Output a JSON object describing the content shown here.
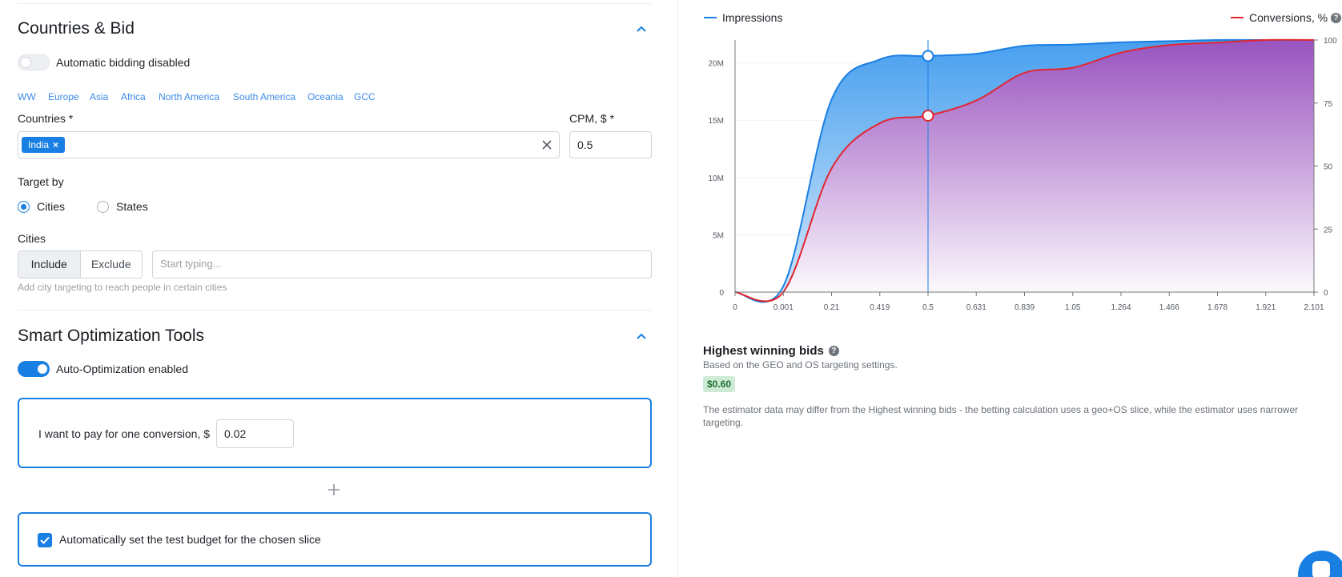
{
  "countries_bid": {
    "title": "Countries & Bid",
    "auto_bidding_label": "Automatic bidding disabled",
    "regions": [
      "WW",
      "Europe",
      "Asia",
      "Africa",
      "North America",
      "South America",
      "Oceania",
      "GCC"
    ],
    "countries_label": "Countries *",
    "selected_country": "India",
    "chip_remove": "×",
    "cpm_label": "CPM, $ *",
    "cpm_value": "0.5",
    "target_by_label": "Target by",
    "target_options": [
      "Cities",
      "States"
    ],
    "selected_target": "Cities",
    "cities_label": "Cities",
    "include_label": "Include",
    "exclude_label": "Exclude",
    "cities_placeholder": "Start typing...",
    "cities_hint": "Add city targeting to reach people in certain cities"
  },
  "smart_tools": {
    "title": "Smart Optimization Tools",
    "auto_opt_label": "Auto-Optimization enabled",
    "pay_label": "I want to pay for one conversion, $",
    "pay_value": "0.02",
    "test_budget_label": "Automatically set the test budget for the chosen slice"
  },
  "chart_data": {
    "type": "area",
    "legend": {
      "impressions": "Impressions",
      "conversions": "Conversions, %"
    },
    "x_ticks": [
      "0",
      "0.001",
      "0.21",
      "0.419",
      "0.5",
      "0.631",
      "0.839",
      "1.05",
      "1.264",
      "1.466",
      "1.678",
      "1.921",
      "2.101"
    ],
    "y_left_ticks": [
      "0",
      "5M",
      "10M",
      "15M",
      "20M"
    ],
    "y_right_ticks": [
      "0",
      "25",
      "50",
      "75",
      "100"
    ],
    "y_left_range": [
      0,
      20000000
    ],
    "y_right_range": [
      0,
      100
    ],
    "series": [
      {
        "name": "Impressions",
        "color": "#1a7fe3",
        "points": [
          [
            0,
            0
          ],
          [
            0.001,
            500000
          ],
          [
            0.21,
            16800000
          ],
          [
            0.419,
            20300000
          ],
          [
            0.5,
            20600000
          ],
          [
            0.631,
            20800000
          ],
          [
            0.839,
            21500000
          ],
          [
            1.05,
            21600000
          ],
          [
            1.264,
            21800000
          ],
          [
            1.466,
            21900000
          ],
          [
            1.678,
            22000000
          ],
          [
            1.921,
            22000000
          ],
          [
            2.101,
            22000000
          ]
        ]
      },
      {
        "name": "Conversions, %",
        "color": "#e2262f",
        "points": [
          [
            0,
            0
          ],
          [
            0.001,
            0
          ],
          [
            0.21,
            49
          ],
          [
            0.419,
            67
          ],
          [
            0.5,
            70
          ],
          [
            0.631,
            76
          ],
          [
            0.839,
            87
          ],
          [
            1.05,
            89
          ],
          [
            1.264,
            95
          ],
          [
            1.466,
            98
          ],
          [
            1.678,
            99
          ],
          [
            1.921,
            100
          ],
          [
            2.101,
            100
          ]
        ]
      }
    ],
    "selected_x": "0.5"
  },
  "bids": {
    "title": "Highest winning bids",
    "subtitle": "Based on the GEO and OS targeting settings.",
    "price": "$0.60",
    "note": "The estimator data may differ from the Highest winning bids - the betting calculation uses a geo+OS slice, while the estimator uses narrower targeting."
  },
  "icons": [
    "chevron-up-icon",
    "close-icon",
    "plus-icon",
    "check-icon",
    "help-icon",
    "chat-icon"
  ]
}
